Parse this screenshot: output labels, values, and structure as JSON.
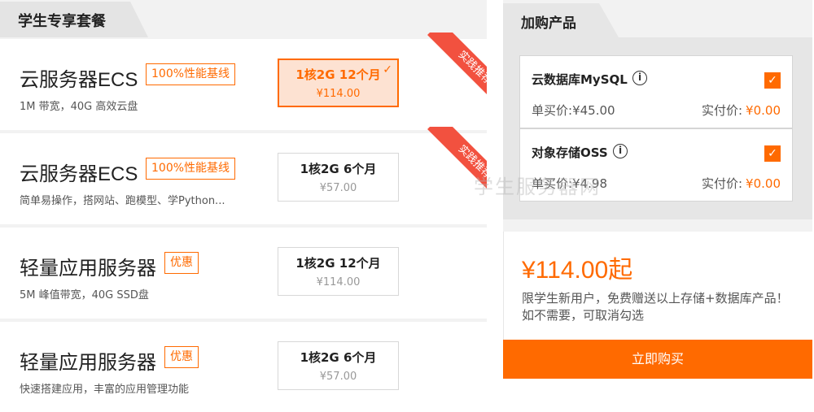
{
  "left_panel": {
    "title": "学生专享套餐",
    "cards": [
      {
        "name": "云服务器ECS",
        "badge": "100%性能基线",
        "desc": "1M 带宽，40G 高效云盘",
        "option_spec": "1核2G 12个月",
        "option_price": "¥114.00",
        "selected": true,
        "ribbon": "实践推荐"
      },
      {
        "name": "云服务器ECS",
        "badge": "100%性能基线",
        "desc": "简单易操作，搭网站、跑模型、学Python...",
        "option_spec": "1核2G 6个月",
        "option_price": "¥57.00",
        "selected": false,
        "ribbon": "实践推荐"
      },
      {
        "name": "轻量应用服务器",
        "badge": "优惠",
        "desc": "5M 峰值带宽，40G SSD盘",
        "option_spec": "1核2G 12个月",
        "option_price": "¥114.00",
        "selected": false
      },
      {
        "name": "轻量应用服务器",
        "badge": "优惠",
        "desc": "快速搭建应用，丰富的应用管理功能",
        "option_spec": "1核2G 6个月",
        "option_price": "¥57.00",
        "selected": false
      }
    ]
  },
  "right_panel": {
    "title": "加购产品",
    "addons": [
      {
        "name": "云数据库MySQL",
        "unit_label": "单买价:",
        "unit_price": "¥45.00",
        "real_label": "实付价:",
        "real_price": "¥0.00",
        "checked": true
      },
      {
        "name": "对象存储OSS",
        "unit_label": "单买价:",
        "unit_price": "¥4.98",
        "real_label": "实付价:",
        "real_price": "¥0.00",
        "checked": true
      }
    ],
    "total": "¥114.00起",
    "note": "限学生新用户，免费赠送以上存储+数据库产品！如不需要，可取消勾选",
    "buy_label": "立即购买"
  },
  "watermark": "学生服务器网",
  "icons": {
    "check": "✓",
    "info": "i",
    "checkbox": "✓"
  },
  "colors": {
    "accent": "#ff6a00",
    "ribbon": "#f2513f",
    "selected_bg": "#fde2d2"
  }
}
